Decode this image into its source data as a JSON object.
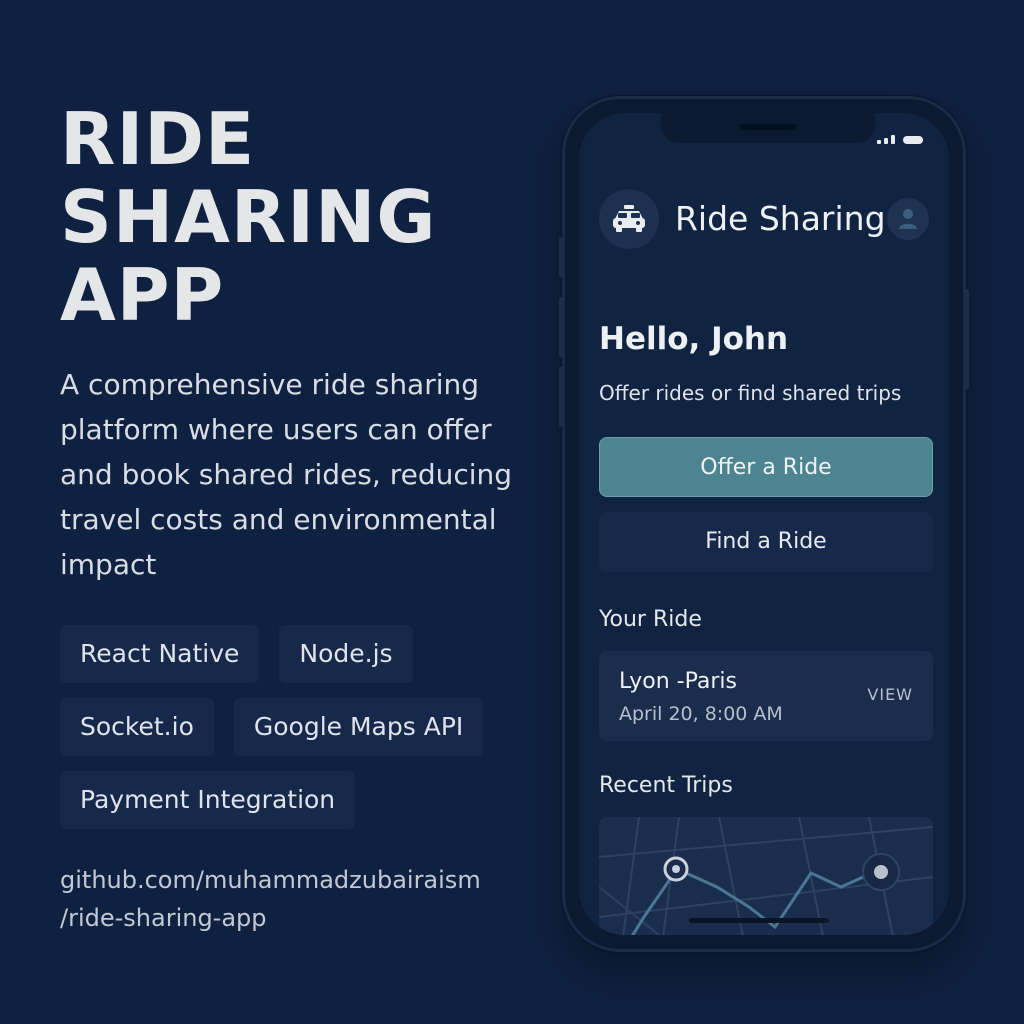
{
  "promo": {
    "title_lines": [
      "RIDE",
      "SHARING",
      "APP"
    ],
    "description": "A comprehensive ride sharing platform where users can offer and book shared rides, reducing travel costs and environmental impact",
    "tags": [
      "React Native",
      "Node.js",
      "Socket.io",
      "Google Maps API",
      "Payment Integration"
    ],
    "repo_lines": [
      "github.com/muhammadzubairaism",
      "/ride-sharing-app"
    ]
  },
  "app": {
    "title": "Ride Sharing",
    "logo_icon": "taxi-car-icon",
    "avatar_icon": "user-icon",
    "greeting": "Hello, John",
    "subtitle": "Offer rides or find shared trips",
    "offer_button": "Offer a Ride",
    "find_button": "Find a Ride",
    "your_ride_heading": "Your Ride",
    "your_ride": {
      "route": "Lyon -Paris",
      "datetime": "April 20, 8:00 AM",
      "action": "VIEW"
    },
    "recent_trips_heading": "Recent Trips"
  },
  "colors": {
    "background": "#0f2140",
    "accent": "#4d8490",
    "card": "#1a2d4d"
  }
}
